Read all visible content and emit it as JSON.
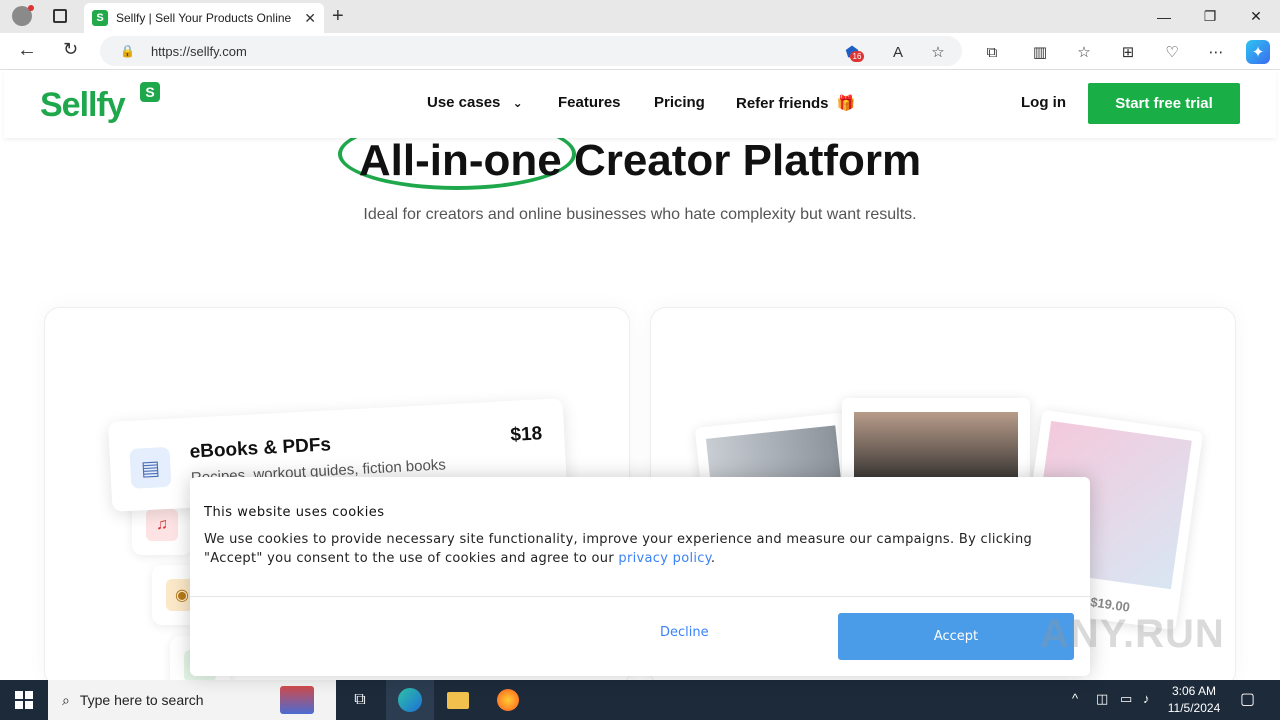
{
  "browser": {
    "tab_title": "Sellfy | Sell Your Products Online",
    "tab_favicon_letter": "S",
    "url": "https://sellfy.com",
    "notification_count": "16"
  },
  "header": {
    "logo_text": "Sellfy",
    "logo_badge": "S",
    "nav": {
      "use_cases": "Use cases",
      "features": "Features",
      "pricing": "Pricing",
      "refer": "Refer friends"
    },
    "login": "Log in",
    "cta": "Start free trial"
  },
  "hero": {
    "title": "All-in-one Creator Platform",
    "subtitle": "Ideal for creators and online businesses who hate complexity but want results."
  },
  "cards": {
    "ebooks": {
      "title": "eBooks & PDFs",
      "subtitle": "Recipes, workout guides, fiction books",
      "price": "$18"
    },
    "merch_price": "$19.00"
  },
  "cookie": {
    "title": "This website uses cookies",
    "text": "We use cookies to provide necessary site functionality, improve your experience and measure our campaigns. By clicking \"Accept\" you consent to the use of cookies and agree to our ",
    "link": "privacy policy",
    "end": ".",
    "decline": "Decline",
    "accept": "Accept"
  },
  "taskbar": {
    "search_placeholder": "Type here to search",
    "time": "3:06 AM",
    "date": "11/5/2024"
  },
  "watermark": "ANY.RUN",
  "colors": {
    "brand_green": "#1fa74c",
    "accept_blue": "#4a9be8",
    "link_blue": "#3b82f6"
  }
}
